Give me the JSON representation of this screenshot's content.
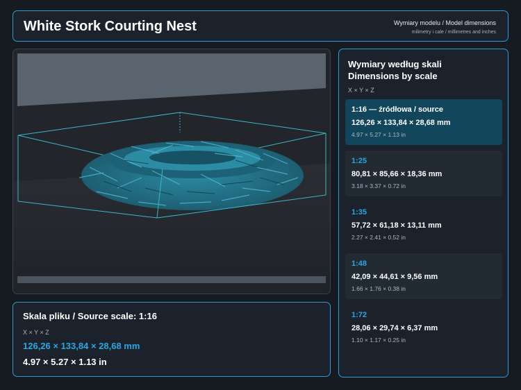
{
  "header": {
    "title": "White Stork Courting Nest",
    "subtitle": "Wymiary modelu / Model dimensions",
    "subtitle2": "milimetry i cale / millimetres and inches"
  },
  "source": {
    "heading": "Skala pliku / Source scale: 1:16",
    "axes": "X × Y × Z",
    "mm": "126,26 × 133,84 × 28,68 mm",
    "inches": "4.97 × 5.27 × 1.13 in"
  },
  "scales_panel": {
    "heading_line1": "Wymiary według skali",
    "heading_line2": "Dimensions by scale",
    "axes": "X × Y × Z",
    "items": [
      {
        "label": "1:16  —  źródłowa / source",
        "mm": "126,26 × 133,84 × 28,68 mm",
        "inches": "4.97 × 5.27 × 1.13 in",
        "state": "active"
      },
      {
        "label": "1:25",
        "mm": "80,81 × 85,66 × 18,36 mm",
        "inches": "3.18 × 3.37 × 0.72 in",
        "state": "shaded"
      },
      {
        "label": "1:35",
        "mm": "57,72 × 61,18 × 13,11 mm",
        "inches": "2.27 × 2.41 × 0.52 in",
        "state": "plain"
      },
      {
        "label": "1:48",
        "mm": "42,09 × 44,61 × 9,56 mm",
        "inches": "1.66 × 1.76 × 0.38 in",
        "state": "shaded"
      },
      {
        "label": "1:72",
        "mm": "28,06 × 29,74 × 6,37 mm",
        "inches": "1.10 × 1.17 × 0.25 in",
        "state": "plain"
      }
    ]
  },
  "colors": {
    "accent": "#2aa7e0",
    "nest": "#2a7f95",
    "active_card": "#12465c",
    "background": "#161b22"
  }
}
